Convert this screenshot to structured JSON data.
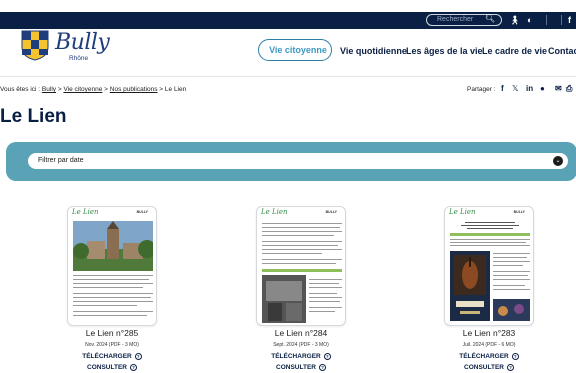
{
  "topbar": {
    "search_placeholder": "Rechercher",
    "icons": [
      "search-icon",
      "accessibility-icon",
      "accessibility-contrast-icon",
      "facebook-icon"
    ]
  },
  "header": {
    "logo_text": "Bully",
    "logo_sub": "Rhône",
    "nav": [
      "Vie citoyenne",
      "Vie quotidienne",
      "Les âges de la vie",
      "Le cadre de vie",
      "Contact"
    ]
  },
  "breadcrumb": {
    "prefix": "Vous êtes ici :",
    "items": [
      "Bully",
      "Vie citoyenne",
      "Nos publications",
      "Le Lien"
    ],
    "separator": ">"
  },
  "share": {
    "label": "Partager :",
    "icons": [
      "facebook-icon",
      "x-icon",
      "linkedin-icon",
      "whatsapp-icon",
      "email-icon",
      "print-icon"
    ]
  },
  "page_title": "Le Lien",
  "filter": {
    "select_value": "Filtrer par date"
  },
  "publications": [
    {
      "title": "Le Lien n°285",
      "meta": "Nov. 2024 (PDF - 3 MO)",
      "download": "TÉLÉCHARGER",
      "consult": "CONSULTER"
    },
    {
      "title": "Le Lien n°284",
      "meta": "Sept. 2024 (PDF - 3 MO)",
      "download": "TÉLÉCHARGER",
      "consult": "CONSULTER"
    },
    {
      "title": "Le Lien n°283",
      "meta": "Juil. 2024 (PDF - 6 MO)",
      "download": "TÉLÉCHARGER",
      "consult": "CONSULTER"
    }
  ],
  "cover": {
    "masthead": "Le Lien",
    "town": "BULLY"
  },
  "colors": {
    "navy": "#0a1f44",
    "teal": "#5aa2b6",
    "accent": "#3d9ac2"
  }
}
